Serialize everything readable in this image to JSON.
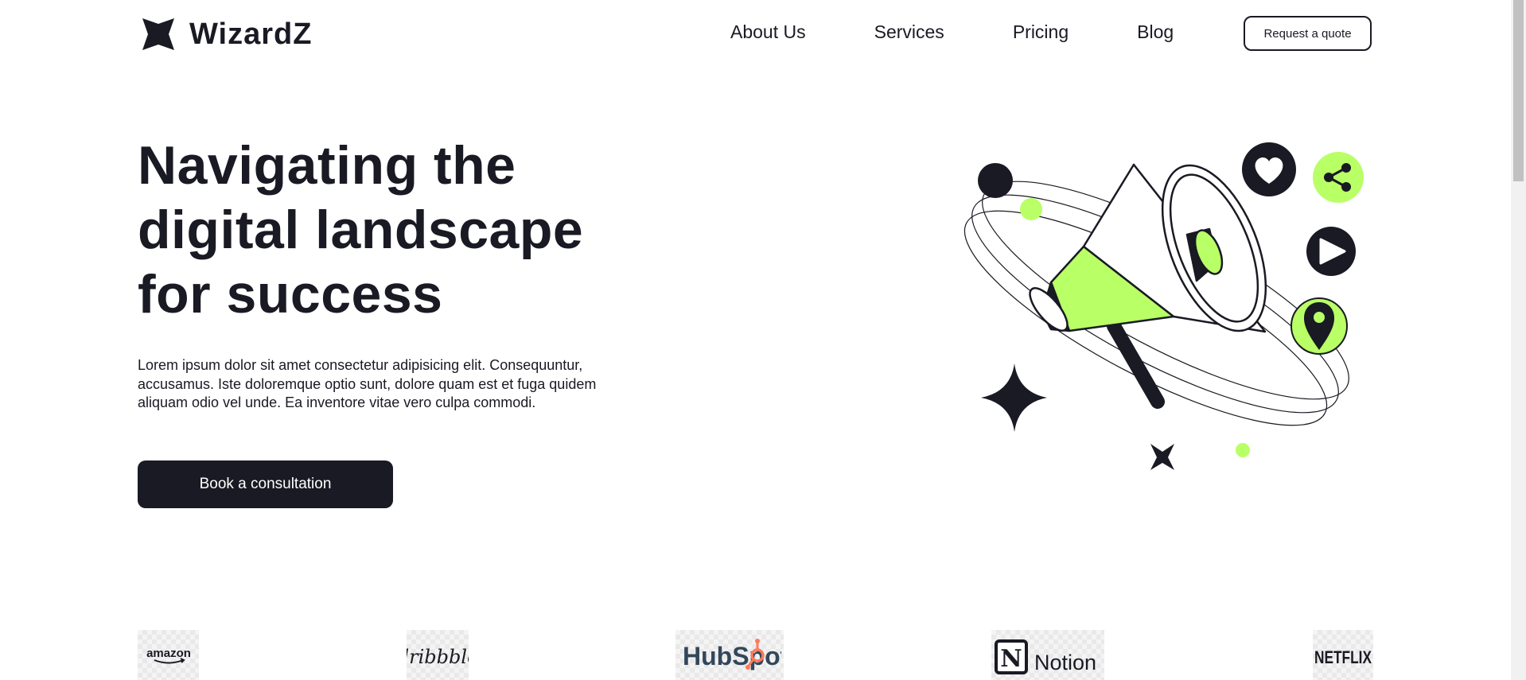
{
  "header": {
    "brand_name": "WizardZ",
    "nav": [
      {
        "label": "About Us"
      },
      {
        "label": "Services"
      },
      {
        "label": "Pricing"
      },
      {
        "label": "Blog"
      }
    ],
    "quote_button": "Request a quote"
  },
  "hero": {
    "title": "Navigating the digital landscape for success",
    "description": "Lorem ipsum dolor sit amet consectetur adipisicing elit. Consequuntur, accusamus. Iste doloremque optio sunt, dolore quam est et fuga quidem aliquam odio vel unde. Ea inventore vitae vero culpa commodi.",
    "cta_button": "Book a consultation"
  },
  "brands": [
    {
      "name": "amazon"
    },
    {
      "name": "dribbble"
    },
    {
      "name": "HubSpot"
    },
    {
      "name": "Notion"
    },
    {
      "name": "NETFLIX"
    }
  ],
  "colors": {
    "dark": "#191a23",
    "accent": "#b9ff66",
    "background": "#ffffff",
    "hubspot_orange": "#ff7a59"
  },
  "icons": {
    "logo": "four-point-star-icon",
    "illustration": [
      "megaphone-icon",
      "heart-icon",
      "share-icon",
      "play-icon",
      "location-pin-icon",
      "sparkle-icon"
    ]
  }
}
